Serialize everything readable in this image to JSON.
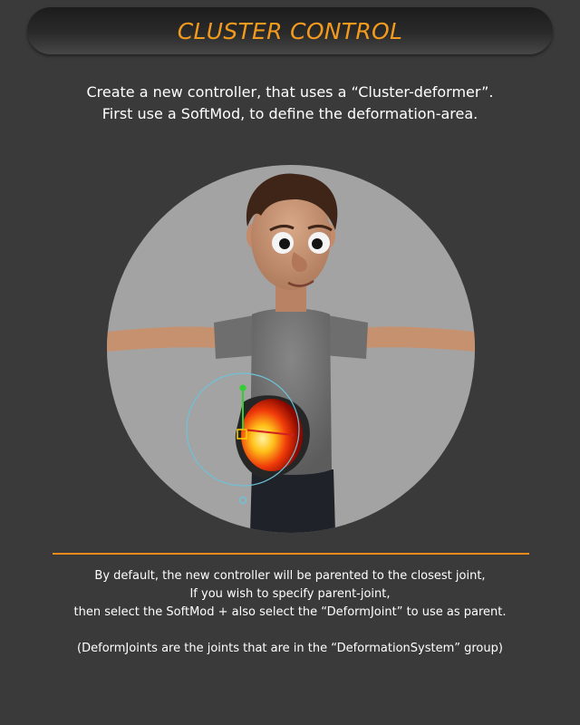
{
  "header": {
    "title": "CLUSTER CONTROL"
  },
  "intro": {
    "line1": "Create a new controller, that uses a “Cluster-deformer”.",
    "line2": "First use a SoftMod, to define the deformation-area."
  },
  "info": {
    "line1": "By default, the new controller will be parented to the closest joint,",
    "line2": "If you wish to specify parent-joint,",
    "line3": "then select the SoftMod + also select the “DeformJoint” to use as parent.",
    "note": "(DeformJoints are the joints that are in the “DeformationSystem” group)"
  },
  "colors": {
    "accent": "#f29a1e",
    "background": "#3a3a3a",
    "viewport": "#a3a3a3",
    "softmod_manipulator": "#6ec2d8"
  },
  "icons": [
    "softmod-manipulator-icon",
    "move-arrow-icon"
  ]
}
